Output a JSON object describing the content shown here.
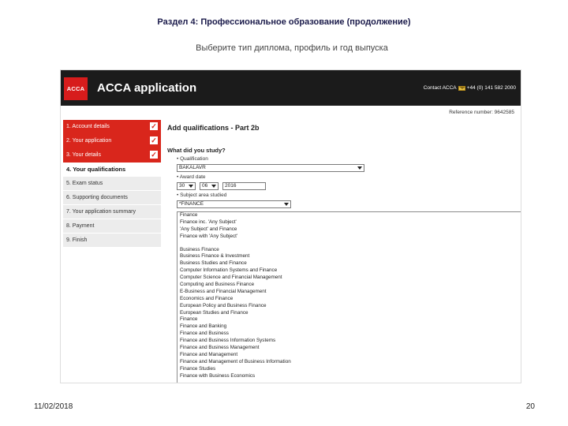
{
  "slide": {
    "title": "Раздел 4: Профессиональное образование (продолжение)",
    "subtitle": "Выберите тип диплома, профиль и год выпуска",
    "date": "11/02/2018",
    "page": "20"
  },
  "header": {
    "logo": "ACCA",
    "title": "ACCA application",
    "contact_prefix": "Contact ACCA",
    "phone": "+44 (0) 141 582 2000"
  },
  "reference": "Reference number: 9642585",
  "sidebar": {
    "items": [
      {
        "label": "1. Account details",
        "state": "done"
      },
      {
        "label": "2. Your application",
        "state": "done"
      },
      {
        "label": "3. Your details",
        "state": "done"
      },
      {
        "label": "4. Your qualifications",
        "state": "active"
      },
      {
        "label": "5. Exam status",
        "state": "todo"
      },
      {
        "label": "6. Supporting documents",
        "state": "todo"
      },
      {
        "label": "7. Your application summary",
        "state": "todo"
      },
      {
        "label": "8. Payment",
        "state": "todo"
      },
      {
        "label": "9. Finish",
        "state": "todo"
      }
    ],
    "check_glyph": "✓"
  },
  "form": {
    "part_title": "Add qualifications - Part 2b",
    "question": "What did you study?",
    "qualification_label": "• Qualification",
    "qualification_value": "BAKALAVR",
    "award_date_label": "• Award date",
    "award_day": "30",
    "award_month": "06",
    "award_year": "2016",
    "subject_label": "• Subject area studied",
    "subject_value": "*FINANCE"
  },
  "subject_list": {
    "top_group": [
      "Finance",
      "Finance inc. 'Any Subject'",
      "'Any Subject' and Finance",
      "Finance with 'Any Subject'"
    ],
    "main_group": [
      "Business Finance",
      "Business Finance & Investment",
      "Business Studies and Finance",
      "Computer Information Systems and Finance",
      "Computer Science and Financial Management",
      "Computing and Business Finance",
      "E-Business and Financial Management",
      "Economics and Finance",
      "European Policy and Business Finance",
      "European Studies and Finance",
      "Finance",
      "Finance and Banking",
      "Finance and Business",
      "Finance and Business Information Systems",
      "Finance and Business Management",
      "Finance and Management",
      "Finance and Management of Business Information",
      "Finance Studies",
      "Finance with Business Economics"
    ]
  },
  "colors": {
    "header_bg": "#1b1b1b",
    "accent_red": "#d9261c",
    "sidebar_todo": "#ececec"
  }
}
